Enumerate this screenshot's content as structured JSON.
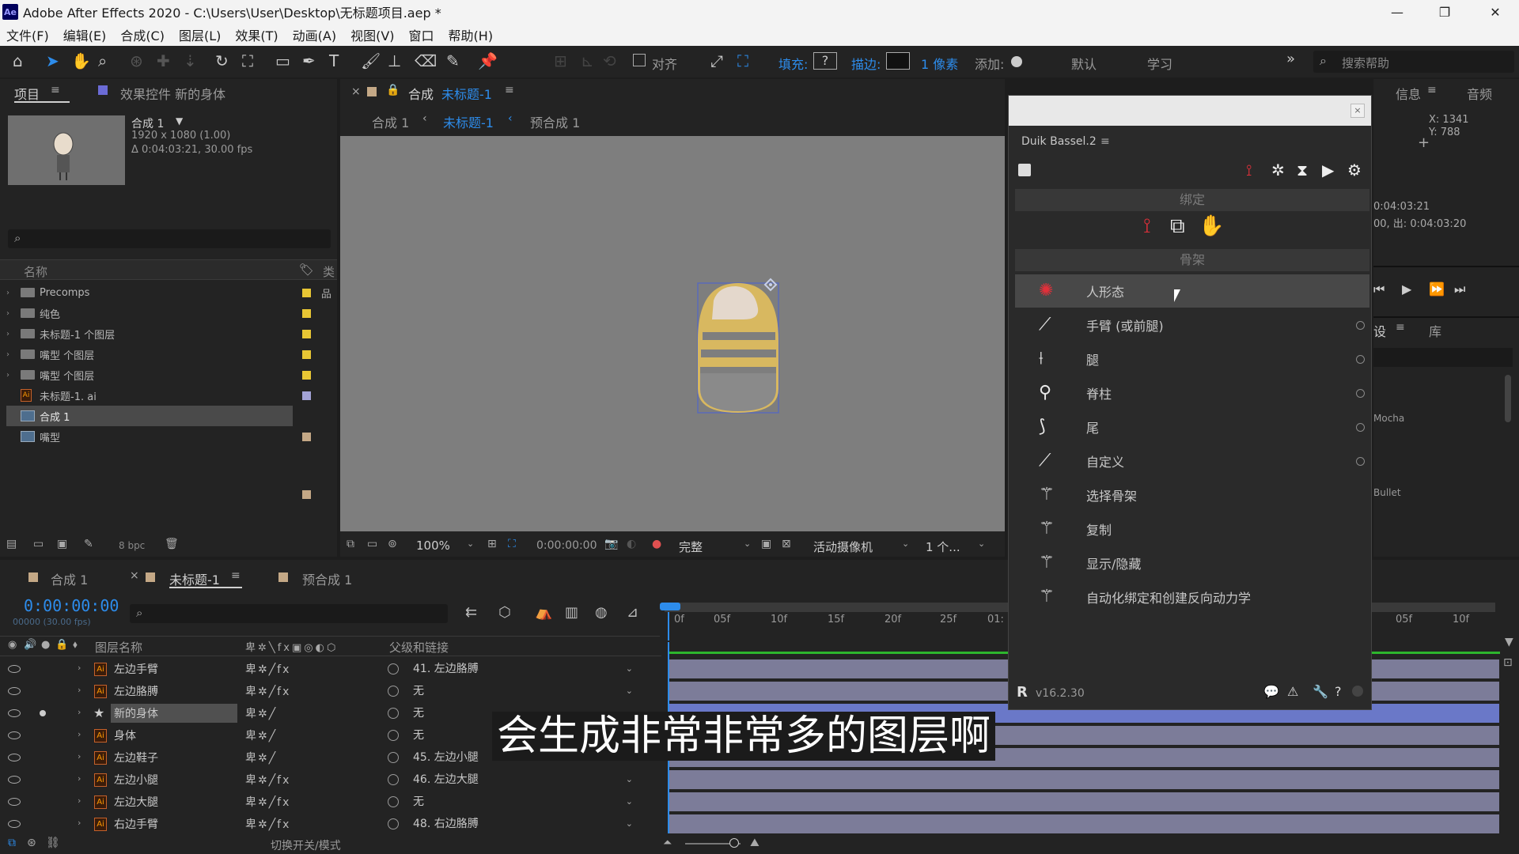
{
  "window": {
    "title": "Adobe After Effects 2020 - C:\\Users\\User\\Desktop\\无标题项目.aep *",
    "app_badge": "Ae"
  },
  "menu": [
    "文件(F)",
    "编辑(E)",
    "合成(C)",
    "图层(L)",
    "效果(T)",
    "动画(A)",
    "视图(V)",
    "窗口",
    "帮助(H)"
  ],
  "toolbar": {
    "align_label": "对齐",
    "fill_label": "填充:",
    "fill_value": "?",
    "stroke_label": "描边:",
    "stroke_width": "1 像素",
    "add_label": "添加:",
    "workspace_default": "默认",
    "workspace_learn": "学习",
    "overflow": "»",
    "search_placeholder": "搜索帮助"
  },
  "project_panel": {
    "tab_project": "项目",
    "tab_effects": "效果控件 新的身体",
    "comp_name": "合成 1",
    "comp_dims": "1920 x 1080 (1.00)",
    "comp_duration": "Δ 0:04:03:21, 30.00 fps",
    "col_name": "名称",
    "col_type": "类",
    "items": [
      {
        "name": "Precomps",
        "kind": "folder",
        "color": "#e8c634"
      },
      {
        "name": "纯色",
        "kind": "folder",
        "color": "#e8c634"
      },
      {
        "name": "未标题-1 个图层",
        "kind": "folder",
        "color": "#e8c634"
      },
      {
        "name": "嘴型 个图层",
        "kind": "folder",
        "color": "#e8c634"
      },
      {
        "name": "嘴型 个图层",
        "kind": "folder",
        "color": "#e8c634"
      },
      {
        "name": "未标题-1. ai",
        "kind": "ai",
        "color": "#a3a3d6"
      },
      {
        "name": "合成 1",
        "kind": "comp",
        "color": "#c4a886",
        "selected": true
      },
      {
        "name": "嘴型",
        "kind": "comp",
        "color": "#c4a886"
      }
    ],
    "bpc": "8 bpc"
  },
  "comp_viewer": {
    "tab_prefix": "合成",
    "tab_name": "未标题-1",
    "crumbs": [
      "合成 1",
      "未标题-1",
      "预合成 1"
    ],
    "zoom": "100%",
    "timecode": "0:00:00:00",
    "resolution": "完整",
    "camera": "活动摄像机",
    "views": "1 个..."
  },
  "info_panel": {
    "tab_info": "信息",
    "tab_audio": "音频",
    "x": "X: 1341",
    "y": "Y: 788",
    "duration_line": "0:04:03:21",
    "inout_line": "00, 出: 0:04:03:20",
    "tab_presets": "设",
    "tab_library": "库",
    "effect_a": "Mocha",
    "effect_b": "Bullet"
  },
  "timeline": {
    "tabs": [
      "合成 1",
      "未标题-1",
      "预合成 1"
    ],
    "timecode": "0:00:00:00",
    "frame_sub": "00000 (30.00 fps)",
    "col_layer": "图层名称",
    "col_parent": "父级和链接",
    "ruler": [
      "0f",
      "05f",
      "10f",
      "15f",
      "20f",
      "25f",
      "01:",
      "05f",
      "10f"
    ],
    "footer": "切换开关/模式",
    "layers": [
      {
        "name": "左边手臂",
        "type": "ai",
        "fx": true,
        "parent": "41. 左边胳膊"
      },
      {
        "name": "左边胳膊",
        "type": "ai",
        "fx": true,
        "parent": "无"
      },
      {
        "name": "新的身体",
        "type": "star",
        "fx": false,
        "parent": "无",
        "selected": true
      },
      {
        "name": "身体",
        "type": "ai",
        "fx": false,
        "parent": "无"
      },
      {
        "name": "左边鞋子",
        "type": "ai",
        "fx": false,
        "parent": "45. 左边小腿"
      },
      {
        "name": "左边小腿",
        "type": "ai",
        "fx": true,
        "parent": "46. 左边大腿"
      },
      {
        "name": "左边大腿",
        "type": "ai",
        "fx": true,
        "parent": "无"
      },
      {
        "name": "右边手臂",
        "type": "ai",
        "fx": true,
        "parent": "48. 右边胳膊"
      }
    ]
  },
  "duik": {
    "title": "Duik Bassel.2",
    "section_rig": "绑定",
    "section_armature": "骨架",
    "items": [
      {
        "label": "人形态",
        "icon": "humanoid-icon",
        "highlighted": true
      },
      {
        "label": "手臂 (或前腿)",
        "icon": "arm-icon"
      },
      {
        "label": "腿",
        "icon": "leg-icon"
      },
      {
        "label": "脊柱",
        "icon": "spine-icon"
      },
      {
        "label": "尾",
        "icon": "tail-icon"
      },
      {
        "label": "自定义",
        "icon": "custom-bone-icon"
      },
      {
        "label": "选择骨架",
        "icon": "select-armature-icon"
      },
      {
        "label": "复制",
        "icon": "duplicate-icon"
      },
      {
        "label": "显示/隐藏",
        "icon": "show-hide-icon"
      },
      {
        "label": "自动化绑定和创建反向动力学",
        "icon": "auto-rig-icon"
      }
    ],
    "version": "v16.2.30"
  },
  "subtitle": "会生成非常非常多的图层啊",
  "colors": {
    "accent_blue": "#2d8ceb",
    "duik_red": "#e0303a",
    "track_lavender": "#7c7c99",
    "label_yellow": "#e8c634"
  }
}
